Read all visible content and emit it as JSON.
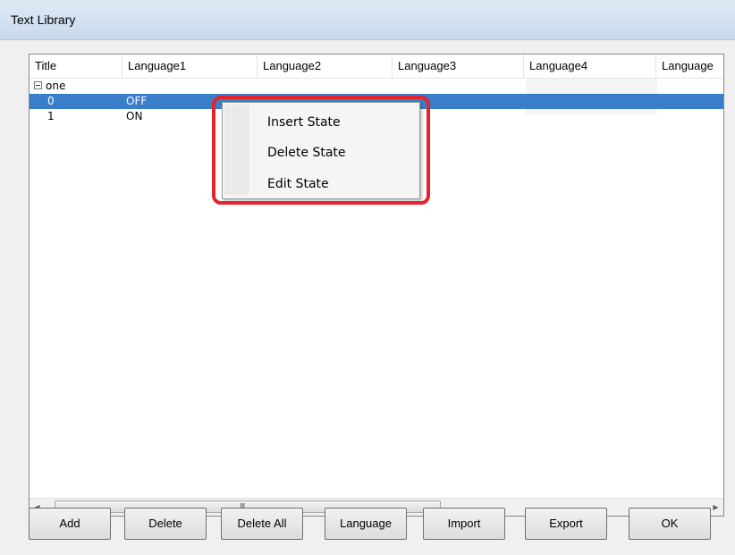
{
  "window": {
    "title": "Text Library"
  },
  "table": {
    "columns": [
      "Title",
      "Language1",
      "Language2",
      "Language3",
      "Language4",
      "Language"
    ],
    "group": {
      "title": "one"
    },
    "rows": [
      {
        "title": "0",
        "language1": "OFF",
        "selected": true
      },
      {
        "title": "1",
        "language1": "ON",
        "selected": false
      }
    ]
  },
  "scrollbar": {
    "left_icon": "scroll-left-icon",
    "right_icon": "scroll-right-icon",
    "grip": "III"
  },
  "context_menu": {
    "items": [
      "Insert State",
      "Delete State",
      "Edit State"
    ]
  },
  "buttons": {
    "add": "Add",
    "delete": "Delete",
    "delete_all": "Delete All",
    "language": "Language",
    "import": "Import",
    "export": "Export",
    "ok": "OK"
  },
  "colors": {
    "selection": "#3a7ec9",
    "highlight": "#e1252f"
  }
}
